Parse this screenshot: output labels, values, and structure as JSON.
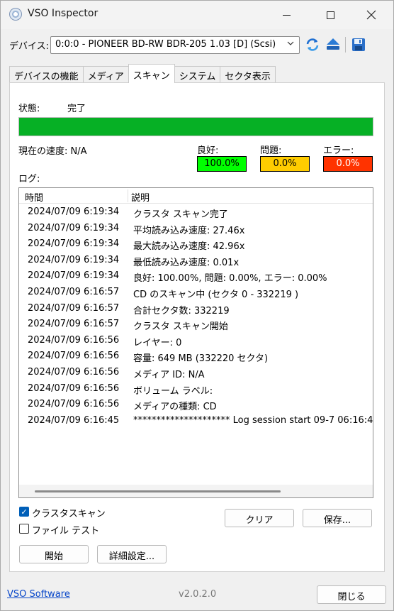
{
  "window": {
    "title": "VSO Inspector"
  },
  "device": {
    "label": "デバイス:",
    "selected": "0:0:0 - PIONEER BD-RW   BDR-205 1.03 [D] (Scsi)"
  },
  "tabs": [
    {
      "label": "デバイスの機能"
    },
    {
      "label": "メディア"
    },
    {
      "label": "スキャン",
      "active": true
    },
    {
      "label": "システム"
    },
    {
      "label": "セクタ表示"
    }
  ],
  "scan": {
    "status_label": "状態:",
    "status_value": "完了",
    "progress": 1.0,
    "speed": "現在の速度: N/A",
    "good_label": "良好:",
    "good_value": "100.0%",
    "problem_label": "問題:",
    "problem_value": "0.0%",
    "error_label": "エラー:",
    "error_value": "0.0%",
    "log_label": "ログ:"
  },
  "log": {
    "col_time": "時間",
    "col_desc": "説明",
    "rows": [
      {
        "time": "2024/07/09 6:19:34",
        "desc": "クラスタ スキャン完了"
      },
      {
        "time": "2024/07/09 6:19:34",
        "desc": "平均読み込み速度: 27.46x"
      },
      {
        "time": "2024/07/09 6:19:34",
        "desc": "最大読み込み速度: 42.96x"
      },
      {
        "time": "2024/07/09 6:19:34",
        "desc": "最低読み込み速度: 0.01x"
      },
      {
        "time": "2024/07/09 6:19:34",
        "desc": "良好: 100.00%, 問題: 0.00%, エラー: 0.00%"
      },
      {
        "time": "2024/07/09 6:16:57",
        "desc": "CD のスキャン中 (セクタ 0 - 332219 )"
      },
      {
        "time": "2024/07/09 6:16:57",
        "desc": "合計セクタ数: 332219"
      },
      {
        "time": "2024/07/09 6:16:57",
        "desc": "クラスタ スキャン開始"
      },
      {
        "time": "2024/07/09 6:16:56",
        "desc": "レイヤー: 0"
      },
      {
        "time": "2024/07/09 6:16:56",
        "desc": "容量: 649 MB (332220 セクタ)"
      },
      {
        "time": "2024/07/09 6:16:56",
        "desc": "メディア ID: N/A"
      },
      {
        "time": "2024/07/09 6:16:56",
        "desc": "ボリューム ラベル:"
      },
      {
        "time": "2024/07/09 6:16:56",
        "desc": "メディアの種類: CD"
      },
      {
        "time": "2024/07/09 6:16:45",
        "desc": "********************* Log session start 09-7 06:16:4"
      }
    ]
  },
  "options": {
    "cluster_scan": "クラスタスキャン",
    "cluster_scan_checked": true,
    "file_test": "ファイル テスト",
    "file_test_checked": false
  },
  "buttons": {
    "clear": "クリア",
    "save": "保存...",
    "start": "開始",
    "advanced": "詳細設定...",
    "close": "閉じる"
  },
  "footer": {
    "link": "VSO Software",
    "version": "v2.0.2.0"
  },
  "colors": {
    "progress": "#06b025",
    "good": "#00ff00",
    "problem": "#ffcc00",
    "error": "#ff3300",
    "accent": "#005fb8"
  }
}
